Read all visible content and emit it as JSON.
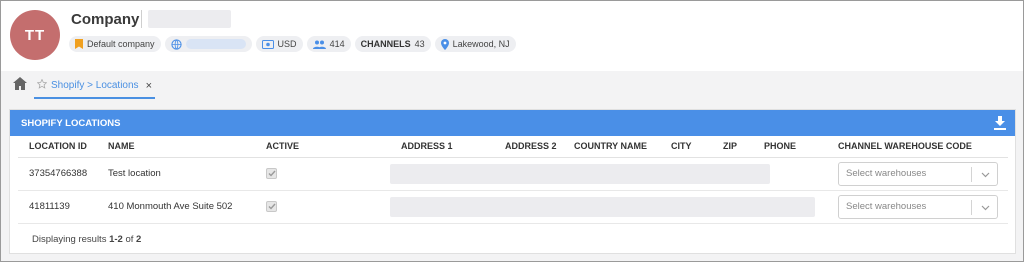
{
  "header": {
    "avatar_initials": "TT",
    "title": "Company",
    "chips": {
      "default_company": "Default company",
      "currency": "USD",
      "users_count": "414",
      "channels_label": "CHANNELS",
      "channels_count": "43",
      "location": "Lakewood, NJ"
    }
  },
  "tabs": [
    {
      "label": "Shopify > Locations",
      "close": "×"
    }
  ],
  "panel": {
    "title": "SHOPIFY LOCATIONS",
    "columns": [
      "LOCATION ID",
      "NAME",
      "ACTIVE",
      "ADDRESS 1",
      "ADDRESS 2",
      "COUNTRY NAME",
      "CITY",
      "ZIP",
      "PHONE",
      "CHANNEL WAREHOUSE CODE"
    ],
    "rows": [
      {
        "location_id": "37354766388",
        "name": "Test location",
        "active": true,
        "warehouse_placeholder": "Select warehouses"
      },
      {
        "location_id": "41811139",
        "name": "410 Monmouth Ave Suite 502",
        "active": true,
        "warehouse_placeholder": "Select warehouses"
      }
    ],
    "footer": {
      "prefix": "Displaying results ",
      "range": "1-2",
      "of": " of ",
      "total": "2"
    }
  },
  "colors": {
    "accent": "#4a8fe7",
    "avatar": "#c46e6e"
  }
}
